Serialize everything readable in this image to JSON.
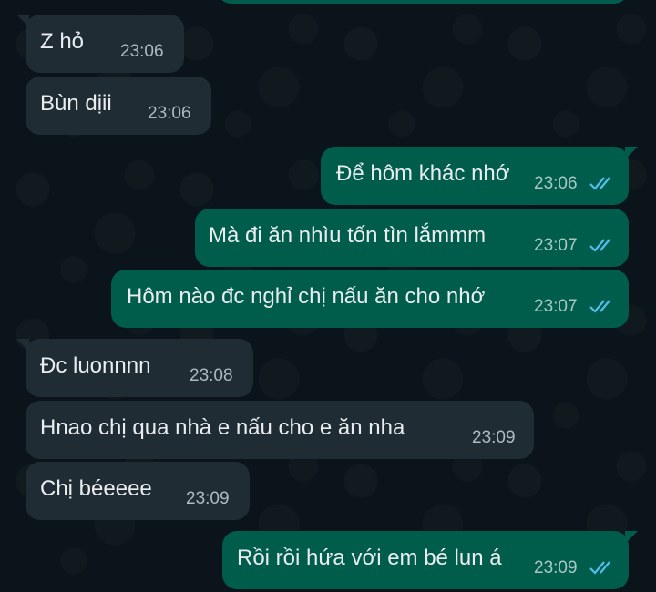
{
  "messages": [
    {
      "text": "Z hỏ",
      "time": "23:06",
      "direction": "incoming"
    },
    {
      "text": "Bùn dịii",
      "time": "23:06",
      "direction": "incoming"
    },
    {
      "text": "Để hôm khác nhớ",
      "time": "23:06",
      "direction": "outgoing",
      "status_icon": "double-check-read-icon"
    },
    {
      "text": "Mà đi ăn nhìu tốn tìn lắmmm",
      "time": "23:07",
      "direction": "outgoing",
      "status_icon": "double-check-read-icon"
    },
    {
      "text": "Hôm nào đc nghỉ chị nấu ăn cho nhớ",
      "time": "23:07",
      "direction": "outgoing",
      "status_icon": "double-check-read-icon"
    },
    {
      "text": "Đc luonnnn",
      "time": "23:08",
      "direction": "incoming"
    },
    {
      "text": "Hnao chị qua nhà e nấu cho e ăn nha",
      "time": "23:09",
      "direction": "incoming"
    },
    {
      "text": "Chị béeeee",
      "time": "23:09",
      "direction": "incoming"
    },
    {
      "text": "Rồi rồi hứa với em bé lun á",
      "time": "23:09",
      "direction": "outgoing",
      "status_icon": "double-check-read-icon"
    }
  ],
  "colors": {
    "background": "#0b141a",
    "incoming_bubble": "#202c33",
    "outgoing_bubble": "#005c4b",
    "read_tick": "#53bdeb"
  }
}
